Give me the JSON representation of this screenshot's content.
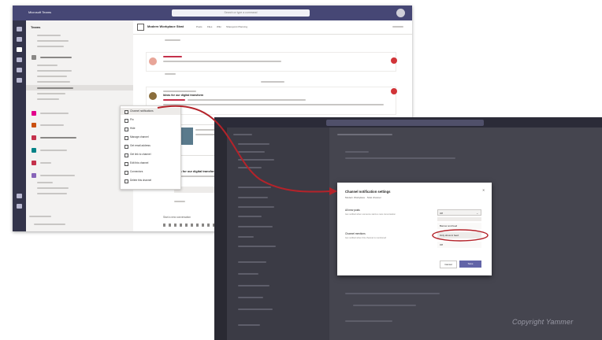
{
  "window1": {
    "app_title": "Microsoft Teams",
    "search_placeholder": "Search or type a command",
    "panel_title": "Teams",
    "channel_title": "Modern Workplace Strat",
    "tabs": [
      "Posts",
      "Files",
      "Wiki",
      "Sharepoint Planning"
    ],
    "context_menu": [
      "Channel notifications",
      "Pin",
      "Hide",
      "Manage channel",
      "Get email address",
      "Get link to channel",
      "Edit this channel",
      "Connectors",
      "Delete this channel"
    ],
    "post_title": "Ideas for our digital transform",
    "new_conversation": "Start a new conversation"
  },
  "dialog": {
    "title": "Channel notification settings",
    "subtitle": "Modern Workplace · Strat channel",
    "all_posts_label": "All new posts",
    "all_posts_desc": "Get notified when someone starts a new conversation",
    "mentions_label": "Channel mentions",
    "mentions_desc": "Get notified when this channel is mentioned",
    "selected_value": "Off",
    "options": [
      "Banner and feed",
      "Only show in feed",
      "Off"
    ],
    "cancel_label": "Cancel",
    "save_label": "Save"
  },
  "watermark": "Copyright Yammer",
  "colors": {
    "teams_purple": "#464775",
    "accent": "#6264a7",
    "highlight_red": "#c4314b",
    "dark_bg": "#35353f"
  },
  "icons": {
    "rail": [
      "activity-icon",
      "chat-icon",
      "teams-icon",
      "calendar-icon",
      "calls-icon",
      "files-icon"
    ]
  }
}
